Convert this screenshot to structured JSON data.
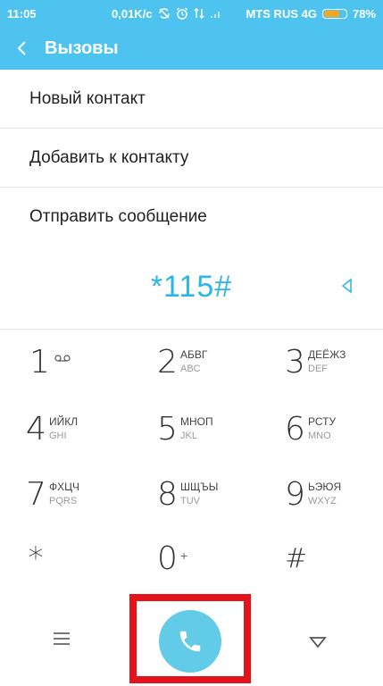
{
  "status": {
    "time": "11:05",
    "speed": "0,01K/c",
    "carrier": "MTS RUS 4G",
    "battery": "78%",
    "battery_level": 0.78,
    "battery_color": "#f5a623"
  },
  "appbar": {
    "title": "Вызовы",
    "back_icon": "chevron-left-icon",
    "color": "#4fc3f0"
  },
  "menu": [
    {
      "label": "Новый контакт"
    },
    {
      "label": "Добавить к контакту"
    },
    {
      "label": "Отправить сообщение"
    }
  ],
  "display": {
    "number": "*115#",
    "accent": "#29b6e8"
  },
  "keypad": [
    {
      "digit": "1",
      "l1": "",
      "l2": "",
      "icon": "voicemail-icon"
    },
    {
      "digit": "2",
      "l1": "АБВГ",
      "l2": "ABC"
    },
    {
      "digit": "3",
      "l1": "ДЕЁЖЗ",
      "l2": "DEF"
    },
    {
      "digit": "4",
      "l1": "ИЙКЛ",
      "l2": "GHI"
    },
    {
      "digit": "5",
      "l1": "МНОП",
      "l2": "JKL"
    },
    {
      "digit": "6",
      "l1": "РСТУ",
      "l2": "MNO"
    },
    {
      "digit": "7",
      "l1": "ФХЦЧ",
      "l2": "PQRS"
    },
    {
      "digit": "8",
      "l1": "ШЩЪЫ",
      "l2": "TUV"
    },
    {
      "digit": "9",
      "l1": "ЬЭЮЯ",
      "l2": "WXYZ"
    },
    {
      "digit": "*",
      "l1": "",
      "l2": ""
    },
    {
      "digit": "0",
      "l1": "+",
      "l2": ""
    },
    {
      "digit": "#",
      "l1": "",
      "l2": ""
    }
  ],
  "bottom": {
    "menu_icon": "hamburger-icon",
    "call_icon": "phone-icon",
    "hide_icon": "triangle-down-icon",
    "highlight_color": "#e3131b",
    "call_color": "#62cbe8"
  }
}
